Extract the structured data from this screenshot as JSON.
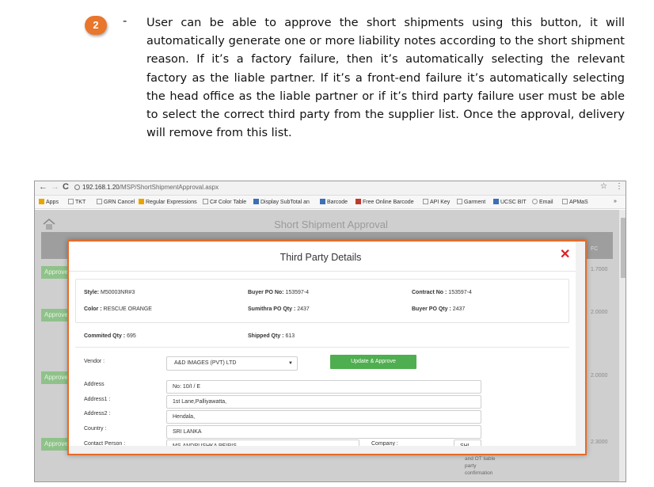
{
  "doc": {
    "step_number": "2",
    "dash": "-",
    "paragraph": "User can be able to approve the short shipments using this button, it will automatically generate one or more liability notes according to the short shipment reason. If it’s a factory failure, then it’s automatically selecting the relevant factory as the liable partner. If it’s a front-end failure it’s automatically selecting the head office as the liable partner or if it’s third party failure user must be able to select the correct third party from the supplier list. Once the approval, delivery will remove from this list."
  },
  "browser": {
    "back": "←",
    "forward": "→",
    "reload": "C",
    "url_host": "192.168.1.20",
    "url_path": "/MSP/ShortShipmentApproval.aspx",
    "star": "☆",
    "menu": "⋮",
    "bookmarks": [
      "Apps",
      "TKT",
      "GRN Cancel",
      "Regular Expressions",
      "C# Color Table",
      "Display SubTotal an",
      "Barcode",
      "Free Online Barcode",
      "API Key",
      "Garment",
      "UCSC BIT",
      "Email",
      "APMaS"
    ],
    "more": "»"
  },
  "app": {
    "title": "Short Shipment Approval",
    "approve_label": "Approve",
    "fc_header": "FC",
    "values": [
      "1.7000",
      "2.0000",
      "2.0000",
      "2.3000"
    ],
    "bg_text": [
      "and OT liable",
      "party",
      "confirmation"
    ]
  },
  "modal": {
    "title": "Third Party Details",
    "close": "✕",
    "style_label": "Style:",
    "style_value": "M50003NR#3",
    "buyer_po_label": "Buyer PO No:",
    "buyer_po_value": "153597-4",
    "contract_label": "Contract No :",
    "contract_value": "153597-4",
    "color_label": "Color :",
    "color_value": "RESCUE ORANGE",
    "sumithra_label": "Sumithra PO Qty :",
    "sumithra_value": "2437",
    "buyer_qty_label": "Buyer PO Qty :",
    "buyer_qty_value": "2437",
    "commited_label": "Commited Qty :",
    "commited_value": "695",
    "shipped_label": "Shipped Qty :",
    "shipped_value": "613",
    "vendor_label": "Vendor :",
    "vendor_value": "A&D IMAGES (PVT) LTD",
    "approve_button": "Update & Approve",
    "address_label": "Address",
    "address_value": "No: 10/I / E",
    "address1_label": "Address1 :",
    "address1_value": "1st Lane,Palliyawatta,",
    "address2_label": "Address2 :",
    "address2_value": "Hendala,",
    "country_label": "Country :",
    "country_value": "SRI LANKA",
    "contact_label": "Contact Person :",
    "contact_value": "MS.ANDRUSHKA PEIRIS",
    "company_label": "Company :",
    "company_value": "SHL"
  }
}
